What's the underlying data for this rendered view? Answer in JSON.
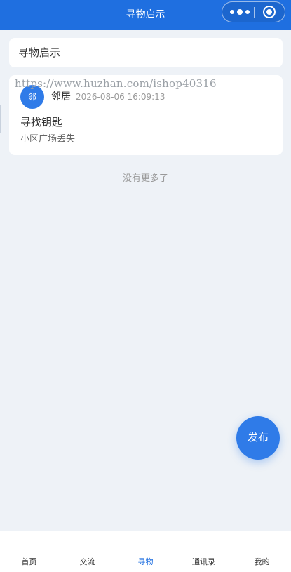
{
  "header": {
    "title": "寻物启示"
  },
  "search": {
    "label": "寻物启示"
  },
  "watermark": {
    "text": "https://www.huzhan.com/ishop40316"
  },
  "posts": [
    {
      "avatar_text": "邻",
      "author": "邻居",
      "time": "2026-08-06 16:09:13",
      "title": "寻找钥匙",
      "desc": "小区广场丢失"
    }
  ],
  "list_end_text": "没有更多了",
  "publish_label": "发布",
  "tabbar": {
    "items": [
      {
        "label": "首页"
      },
      {
        "label": "交流"
      },
      {
        "label": "寻物",
        "active": true
      },
      {
        "label": "通讯录"
      },
      {
        "label": "我的"
      }
    ]
  },
  "colors": {
    "primary": "#1f6fe0",
    "accent": "#2f7be8",
    "background": "#eef2f7"
  }
}
